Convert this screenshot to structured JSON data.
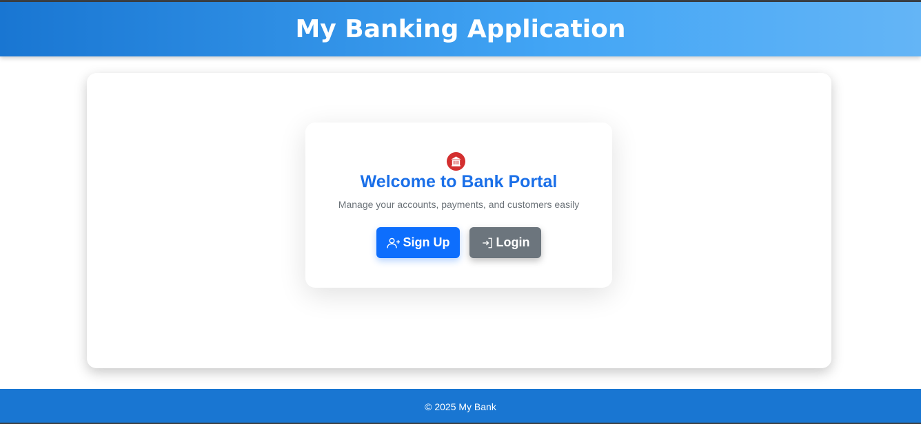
{
  "header": {
    "title": "My Banking Application"
  },
  "welcome": {
    "icon": "bank-icon",
    "title": "Welcome to Bank Portal",
    "subtitle": "Manage your accounts, payments, and customers easily"
  },
  "actions": {
    "signup_label": "Sign Up",
    "signup_icon": "user-plus-icon",
    "login_label": "Login",
    "login_icon": "login-arrow-icon"
  },
  "footer": {
    "text": "© 2025 My Bank"
  },
  "colors": {
    "header_gradient_start": "#1976d2",
    "header_gradient_end": "#64b5f6",
    "title_blue": "#1a6fe8",
    "primary_button": "#0d6efd",
    "secondary_button": "#6c757d",
    "bank_icon_bg": "#d32f2f",
    "footer_bg": "#1976d2"
  }
}
